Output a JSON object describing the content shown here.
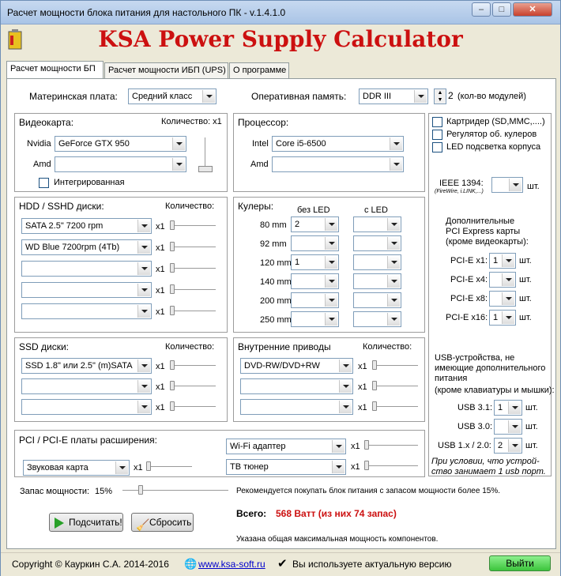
{
  "window": {
    "title": "Расчет мощности блока питания для настольного ПК - v.1.4.1.0",
    "app_title": "KSA Power Supply Calculator",
    "controls": {
      "minimize": "–",
      "maximize": "□",
      "close": "✕"
    }
  },
  "tabs": [
    "Расчет мощности БП",
    "Расчет мощности ИБП (UPS)",
    "О программе"
  ],
  "motherboard": {
    "label": "Материнская плата:",
    "value": "Средний класс"
  },
  "ram": {
    "label": "Оперативная память:",
    "value": "DDR III",
    "count": "2",
    "count_label": "(кол-во модулей)"
  },
  "gpu": {
    "title": "Видеокарта:",
    "qty_label": "Количество: x1",
    "nvidia_label": "Nvidia",
    "nvidia_value": "GeForce GTX 950",
    "amd_label": "Amd",
    "amd_value": "",
    "integrated_label": "Интегрированная"
  },
  "cpu": {
    "title": "Процессор:",
    "intel_label": "Intel",
    "intel_value": "Core i5-6500",
    "amd_label": "Amd",
    "amd_value": ""
  },
  "extras": {
    "items": [
      "Картридер (SD,MMC,....)",
      "Регулятор об. кулеров",
      "LED подсветка корпуса"
    ],
    "ieee_label": "IEEE 1394:",
    "ieee_sub": "(FireWire, i.LINK,...)",
    "ieee_unit": "шт."
  },
  "hdd": {
    "title": "HDD / SSHD диски:",
    "qty_label": "Количество:",
    "rows": [
      {
        "value": "SATA 2.5\" 7200 rpm",
        "mult": "x1"
      },
      {
        "value": "WD Blue 7200rpm (4Tb)",
        "mult": "x1"
      },
      {
        "value": "",
        "mult": "x1"
      },
      {
        "value": "",
        "mult": "x1"
      },
      {
        "value": "",
        "mult": "x1"
      }
    ]
  },
  "coolers": {
    "title": "Кулеры:",
    "col1": "без LED",
    "col2": "с LED",
    "rows": [
      {
        "size": "80 mm",
        "noled": "2",
        "led": ""
      },
      {
        "size": "92 mm",
        "noled": "",
        "led": ""
      },
      {
        "size": "120 mm",
        "noled": "1",
        "led": ""
      },
      {
        "size": "140 mm",
        "noled": "",
        "led": ""
      },
      {
        "size": "200 mm",
        "noled": "",
        "led": ""
      },
      {
        "size": "250 mm",
        "noled": "",
        "led": ""
      }
    ]
  },
  "pcie": {
    "title1": "Дополнительные",
    "title2": "PCI Express карты",
    "title3": "(кроме видеокарты):",
    "unit": "шт.",
    "rows": [
      {
        "label": "PCI-E x1:",
        "value": "1"
      },
      {
        "label": "PCI-E x4:",
        "value": ""
      },
      {
        "label": "PCI-E x8:",
        "value": ""
      },
      {
        "label": "PCI-E x16:",
        "value": "1"
      }
    ]
  },
  "ssd": {
    "title": "SSD диски:",
    "qty_label": "Количество:",
    "rows": [
      {
        "value": "SSD 1.8\" или 2.5\" (m)SATA",
        "mult": "x1"
      },
      {
        "value": "",
        "mult": "x1"
      },
      {
        "value": "",
        "mult": "x1"
      }
    ]
  },
  "drives": {
    "title": "Внутренние приводы",
    "qty_label": "Количество:",
    "rows": [
      {
        "value": "DVD-RW/DVD+RW",
        "mult": "x1"
      },
      {
        "value": "",
        "mult": "x1"
      },
      {
        "value": "",
        "mult": "x1"
      }
    ]
  },
  "usb": {
    "title1": "USB-устройства, не",
    "title2": "имеющие дополнительного",
    "title3": "питания",
    "title4": "(кроме клавиатуры и мышки):",
    "unit": "шт.",
    "rows": [
      {
        "label": "USB 3.1:",
        "value": "1"
      },
      {
        "label": "USB 3.0:",
        "value": ""
      },
      {
        "label": "USB 1.x / 2.0:",
        "value": "2"
      }
    ],
    "note1": "При условии, что устрой-",
    "note2": "ство занимает 1 usb порт."
  },
  "expansion": {
    "title": "PCI / PCI-E платы расширения:",
    "left": {
      "value": "Звуковая карта",
      "mult": "x1"
    },
    "right": [
      {
        "value": "Wi-Fi адаптер",
        "mult": "x1"
      },
      {
        "value": "ТВ тюнер",
        "mult": "x1"
      }
    ]
  },
  "reserve": {
    "label": "Запас мощности:",
    "value": "15%",
    "fraction": 0.15,
    "recommend": "Рекомендуется покупать блок питания с запасом мощности более 15%."
  },
  "actions": {
    "calc": "Подсчитать!",
    "reset": "Сбросить"
  },
  "result": {
    "label": "Всего:",
    "value": "568 Ватт  (из них 74 запас)",
    "note": "Указана общая максимальная мощность компонентов."
  },
  "colors": {
    "accent_red": "#cc1010",
    "exit_green": "#5cd65c"
  },
  "status": {
    "copyright": "Copyright © Кауркин С.А. 2014-2016",
    "site": "www.ksa-soft.ru",
    "version_msg": "Вы используете актуальную версию",
    "exit": "Выйти"
  }
}
